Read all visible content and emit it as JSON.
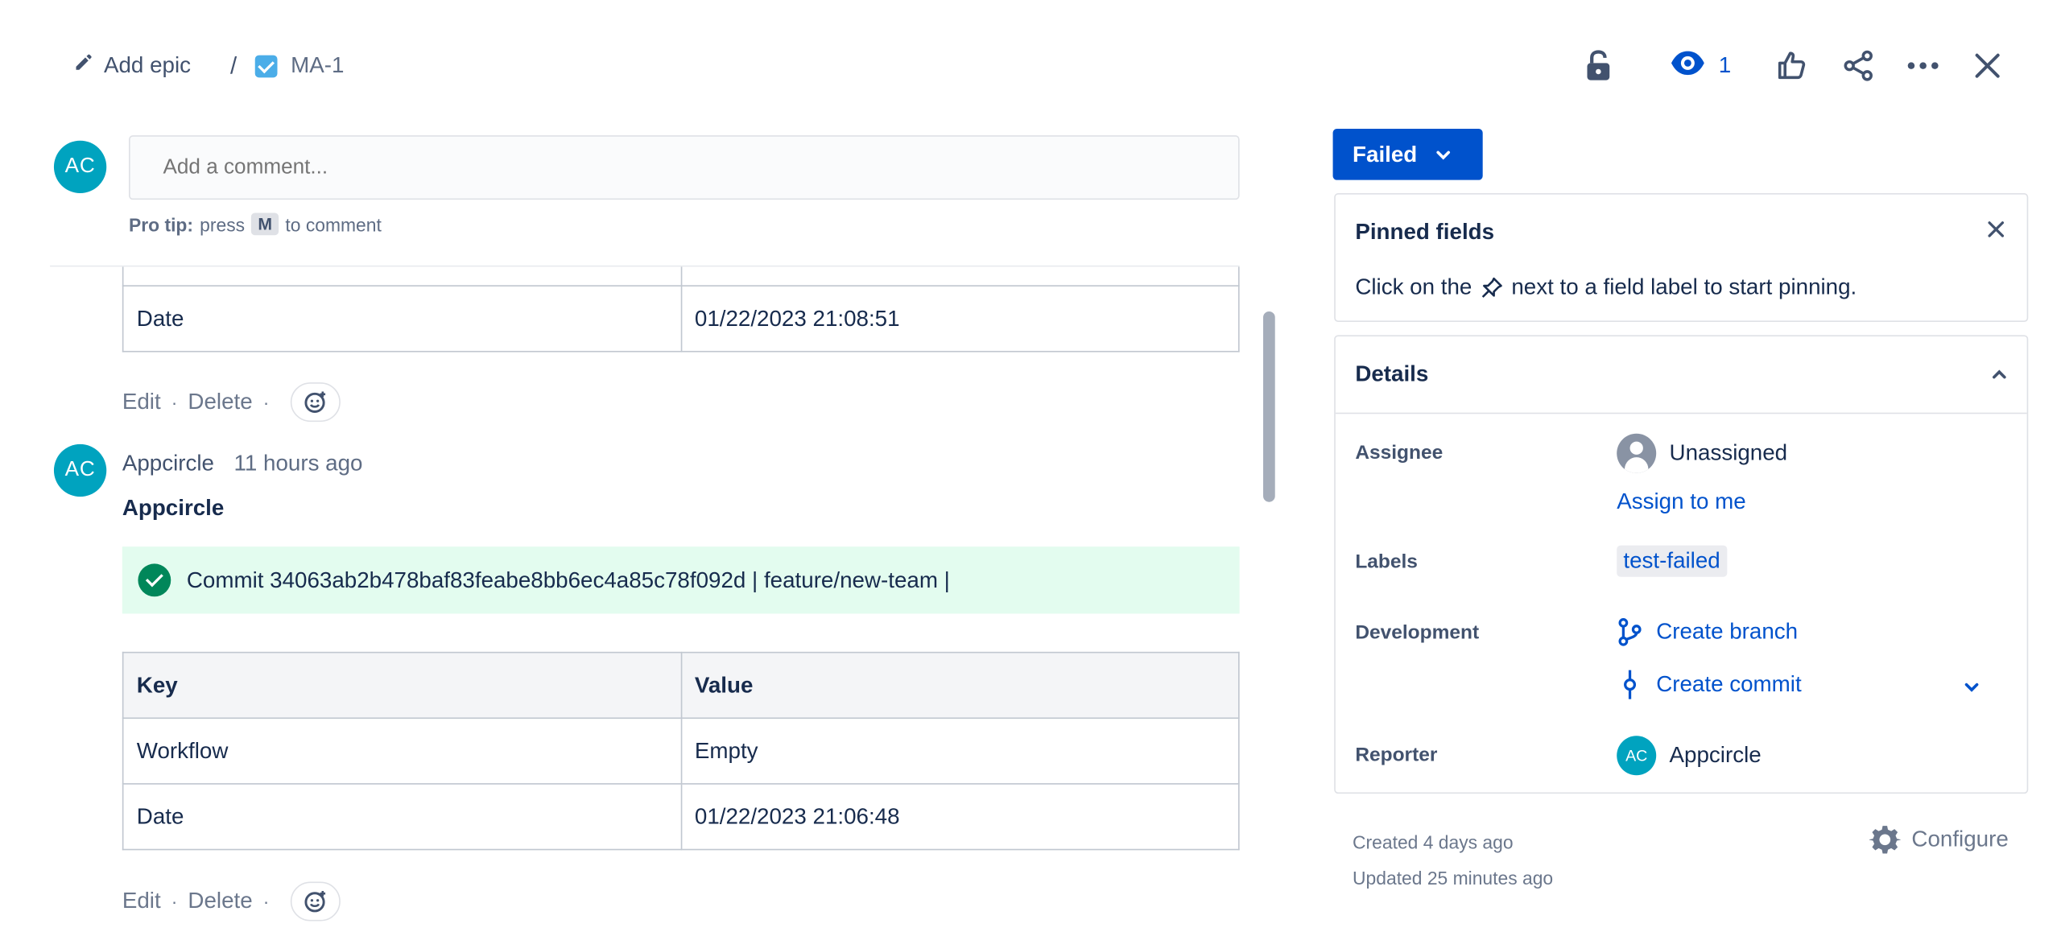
{
  "breadcrumbs": {
    "add_epic": "Add epic",
    "separator": "/",
    "issue_key": "MA-1"
  },
  "toolbar": {
    "watchers_count": "1",
    "icons": [
      "unlock-icon",
      "eye-icon",
      "thumbs-up-icon",
      "share-icon",
      "more-icon",
      "close-icon"
    ]
  },
  "composer": {
    "avatar_initials": "AC",
    "placeholder": "Add a comment...",
    "protip_label": "Pro tip:",
    "protip_press": "press",
    "protip_key": "M",
    "protip_suffix": "to comment"
  },
  "comments": [
    {
      "table": {
        "rows": [
          {
            "key": "Date",
            "value": "01/22/2023 21:08:51"
          }
        ]
      },
      "actions": {
        "edit": "Edit",
        "delete": "Delete",
        "dot": "·"
      }
    },
    {
      "avatar_initials": "AC",
      "author": "Appcircle",
      "time": "11 hours ago",
      "title": "Appcircle",
      "banner": "Commit 34063ab2b478baf83feabe8bb6ec4a85c78f092d | feature/new-team |",
      "table": {
        "headers": {
          "key": "Key",
          "value": "Value"
        },
        "rows": [
          {
            "key": "Workflow",
            "value": "Empty"
          },
          {
            "key": "Date",
            "value": "01/22/2023 21:06:48"
          }
        ]
      },
      "actions": {
        "edit": "Edit",
        "delete": "Delete",
        "dot": "·"
      }
    }
  ],
  "status": {
    "label": "Failed"
  },
  "pinned": {
    "title": "Pinned fields",
    "message_before": "Click on the",
    "message_after": "next to a field label to start pinning."
  },
  "details": {
    "title": "Details",
    "assignee": {
      "label": "Assignee",
      "value": "Unassigned",
      "action": "Assign to me"
    },
    "labels": {
      "label": "Labels",
      "value": "test-failed"
    },
    "development": {
      "label": "Development",
      "create_branch": "Create branch",
      "create_commit": "Create commit"
    },
    "reporter": {
      "label": "Reporter",
      "initials": "AC",
      "value": "Appcircle"
    }
  },
  "meta": {
    "created": "Created 4 days ago",
    "updated": "Updated 25 minutes ago",
    "configure": "Configure"
  },
  "colors": {
    "primary": "#0052cc",
    "avatar": "#00a3bf",
    "success_bg": "#e3fcef",
    "success_icon": "#00875a",
    "text": "#172b4d"
  }
}
